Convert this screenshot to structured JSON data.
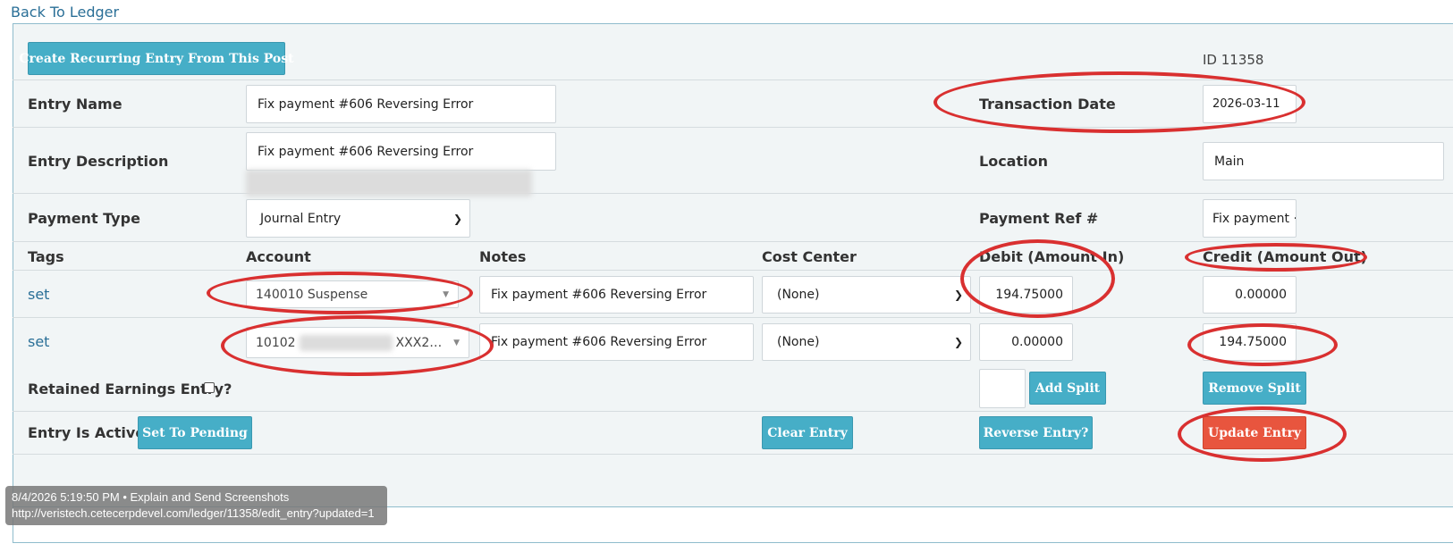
{
  "back_link": "Back To Ledger",
  "toolbar": {
    "create_recurring": "Create Recurring Entry From This Post"
  },
  "id_label": "ID 11358",
  "entry_name": {
    "label": "Entry Name",
    "value": "Fix payment #606 Reversing Error"
  },
  "transaction_date": {
    "label": "Transaction Date",
    "value": "2026-03-11"
  },
  "entry_description": {
    "label": "Entry Description",
    "value": "Fix payment #606 Reversing  Error"
  },
  "location": {
    "label": "Location",
    "value": "Main"
  },
  "payment_type": {
    "label": "Payment Type",
    "value": "Journal Entry"
  },
  "payment_ref": {
    "label": "Payment Ref #",
    "value": "Fix payment ·"
  },
  "columns": {
    "tags": "Tags",
    "account": "Account",
    "notes": "Notes",
    "cost_center": "Cost Center",
    "debit": "Debit (Amount In)",
    "credit": "Credit (Amount Out)"
  },
  "lines": [
    {
      "tags": "set",
      "account": "140010 Suspense",
      "notes": "Fix payment #606 Reversing Error",
      "cost_center": "(None)",
      "debit": "194.75000",
      "credit": "0.00000"
    },
    {
      "tags": "set",
      "account_prefix": "10102",
      "account_suffix": "XXX2…",
      "notes": "Fix payment #606 Reversing Error",
      "cost_center": "(None)",
      "debit": "0.00000",
      "credit": "194.75000"
    }
  ],
  "retained_earnings": {
    "label": "Retained Earnings Entry?"
  },
  "buttons": {
    "add_split": "Add Split",
    "remove_split": "Remove Split",
    "set_to_pending": "Set To Pending",
    "clear_entry": "Clear Entry",
    "reverse_entry": "Reverse Entry?",
    "update_entry": "Update Entry"
  },
  "status": {
    "label": "Entry Is Active"
  },
  "tooltip": {
    "line1": "8/4/2026 5:19:50 PM • Explain and Send Screenshots",
    "line2": "http://veristech.cetecerpdevel.com/ledger/11358/edit_entry?updated=1"
  },
  "colors": {
    "accent": "#46aec7",
    "danger": "#e8553e",
    "annotation": "#d93030",
    "link": "#2a6f97"
  }
}
